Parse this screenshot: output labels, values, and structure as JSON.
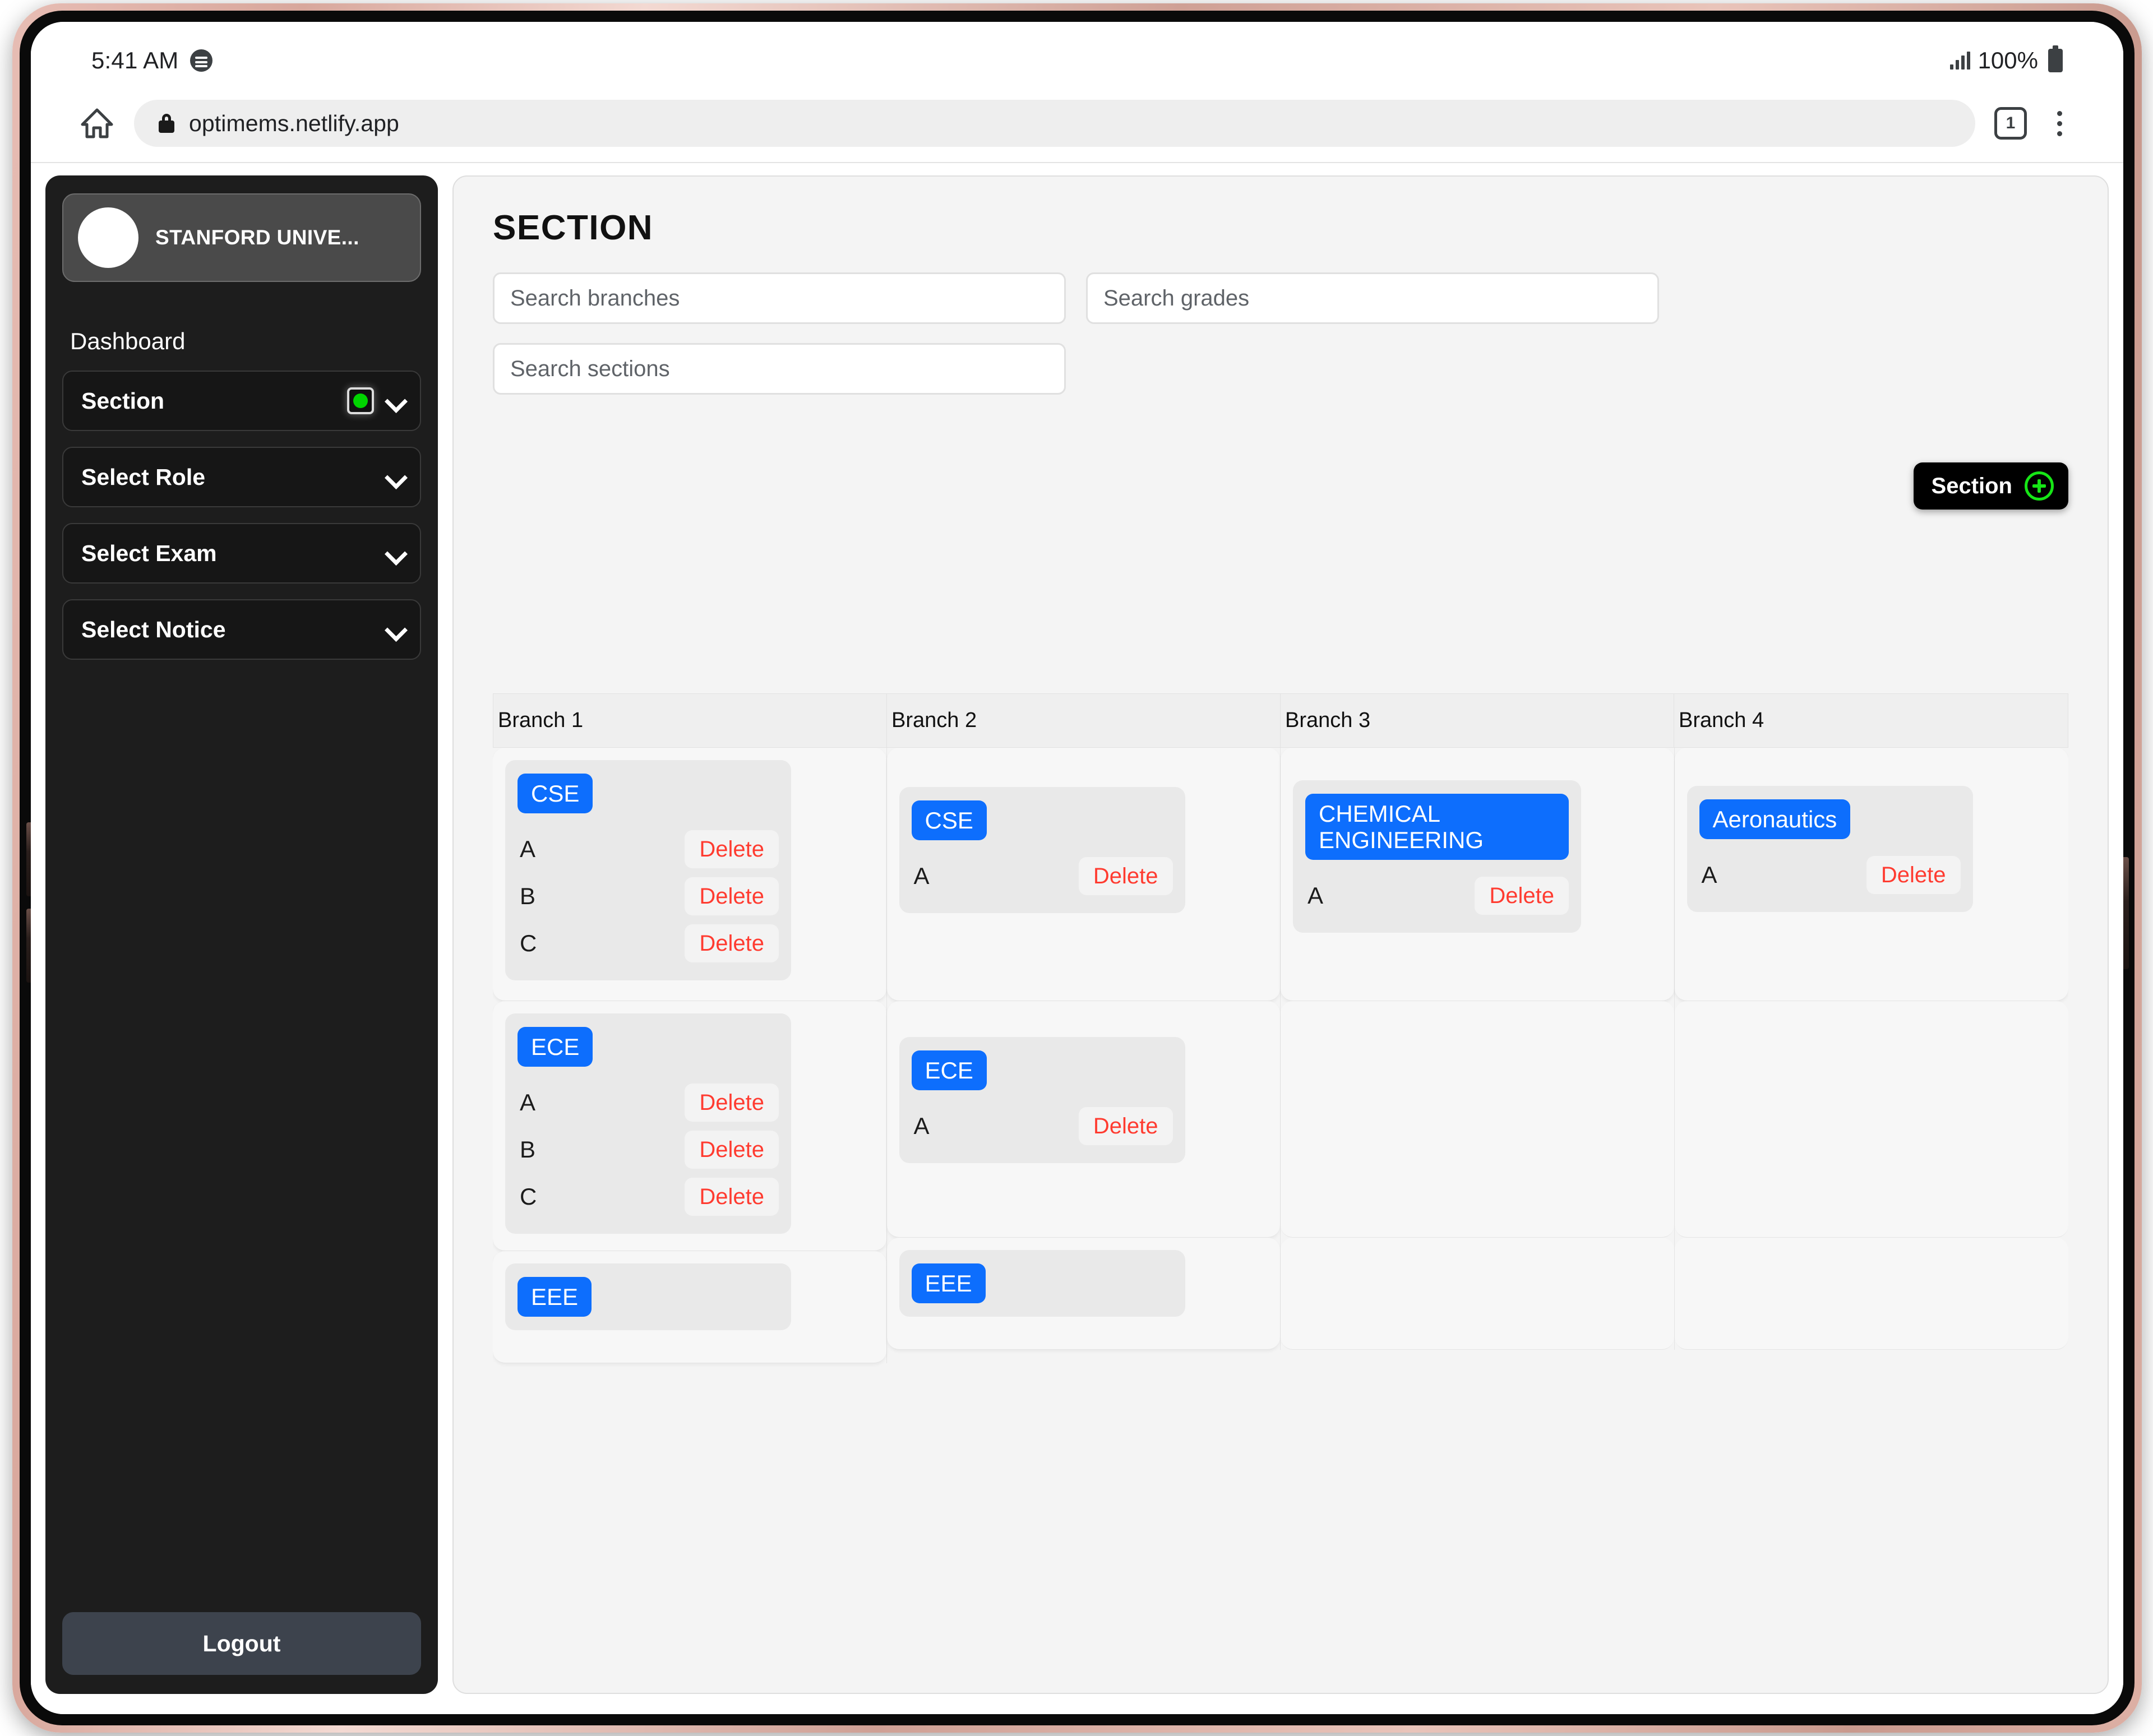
{
  "status_bar": {
    "time": "5:41 AM",
    "media_icon": "spotify-icon",
    "signal_icon": "signal-bars-icon",
    "battery_percent": "100%",
    "battery_icon": "battery-full-icon"
  },
  "browser": {
    "home_icon": "home-icon",
    "lock_icon": "lock-icon",
    "url": "optimems.netlify.app",
    "tab_count": "1",
    "menu_icon": "overflow-menu-icon"
  },
  "sidebar": {
    "org_name": "STANFORD UNIVE...",
    "avatar_icon": "avatar-placeholder",
    "nav_heading": "Dashboard",
    "items": [
      {
        "label": "Section",
        "has_status_dot": true,
        "status_color": "#00d400",
        "chevron": "chevron-down-icon"
      },
      {
        "label": "Select Role",
        "has_status_dot": false,
        "chevron": "chevron-down-icon"
      },
      {
        "label": "Select Exam",
        "has_status_dot": false,
        "chevron": "chevron-down-icon"
      },
      {
        "label": "Select Notice",
        "has_status_dot": false,
        "chevron": "chevron-down-icon"
      }
    ],
    "logout_label": "Logout"
  },
  "main": {
    "title": "SECTION",
    "add_button": {
      "label": "Section",
      "icon": "plus-circle-icon",
      "icon_color": "#16e616"
    },
    "filters": [
      {
        "name": "search-branches-input",
        "placeholder": "Search branches",
        "value": ""
      },
      {
        "name": "search-grades-input",
        "placeholder": "Search grades",
        "value": ""
      },
      {
        "name": "search-sections-input",
        "placeholder": "Search sections",
        "value": ""
      }
    ],
    "columns": [
      {
        "header": "Branch 1"
      },
      {
        "header": "Branch 2"
      },
      {
        "header": "Branch 3"
      },
      {
        "header": "Branch 4"
      }
    ],
    "delete_label": "Delete",
    "accent_badge_color": "#0d6efd",
    "delete_text_color": "#ff3b30",
    "grid": [
      [
        {
          "grade": "CSE",
          "sections": [
            "A",
            "B",
            "C"
          ]
        },
        {
          "grade": "CSE",
          "sections": [
            "A"
          ]
        },
        {
          "grade": "CHEMICAL ENGINEERING",
          "sections": [
            "A"
          ]
        },
        {
          "grade": "Aeronautics",
          "sections": [
            "A"
          ]
        }
      ],
      [
        {
          "grade": "ECE",
          "sections": [
            "A",
            "B",
            "C"
          ]
        },
        {
          "grade": "ECE",
          "sections": [
            "A"
          ]
        },
        {
          "grade": null,
          "sections": []
        },
        {
          "grade": null,
          "sections": []
        }
      ],
      [
        {
          "grade": "EEE",
          "sections": []
        },
        {
          "grade": "EEE",
          "sections": []
        },
        {
          "grade": null,
          "sections": []
        },
        {
          "grade": null,
          "sections": []
        }
      ]
    ]
  }
}
